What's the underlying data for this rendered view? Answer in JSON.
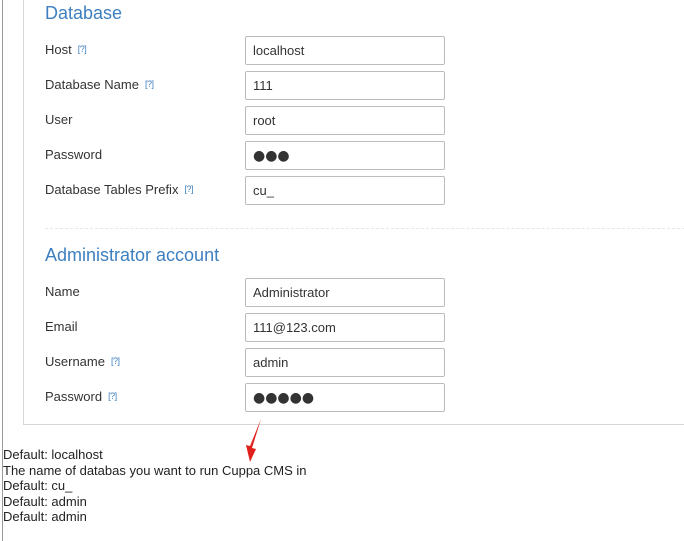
{
  "database": {
    "title": "Database",
    "help_glyph": "[?]",
    "fields": [
      {
        "label": "Host",
        "value": "localhost",
        "has_help": true
      },
      {
        "label": "Database Name",
        "value": "111",
        "has_help": true
      },
      {
        "label": "User",
        "value": "root",
        "has_help": false
      },
      {
        "label": "Password",
        "value": "●●●",
        "has_help": false
      },
      {
        "label": "Database Tables Prefix",
        "value": "cu_",
        "has_help": true
      }
    ]
  },
  "admin": {
    "title": "Administrator account",
    "fields": [
      {
        "label": "Name",
        "value": "Administrator",
        "has_help": false
      },
      {
        "label": "Email",
        "value": "111@123.com",
        "has_help": false
      },
      {
        "label": "Username",
        "value": "admin",
        "has_help": true
      },
      {
        "label": "Password",
        "value": "●●●●●",
        "has_help": true
      }
    ]
  },
  "defaults": [
    "Default: localhost",
    "The name of databas you want to run Cuppa CMS in",
    "Default: cu_",
    "Default: admin",
    "Default: admin"
  ],
  "colors": {
    "accent": "#3d7fbf",
    "annotation_arrow": "#e0201b"
  }
}
